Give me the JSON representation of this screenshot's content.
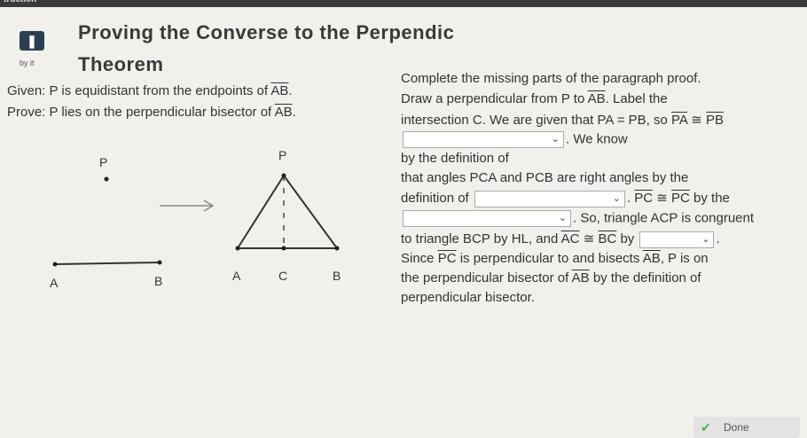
{
  "header": {
    "corner_text": "truction",
    "badge_sub": "by it",
    "title_line1": "Proving the Converse to the Perpendic",
    "title_line2": "Theorem"
  },
  "given": {
    "prefix": "Given: P is equidistant from the endpoints of",
    "segment": "AB",
    "suffix": "."
  },
  "prove": {
    "prefix": "Prove: P lies on the perpendicular bisector of",
    "segment": "AB",
    "suffix": "."
  },
  "paragraph": {
    "l1": "Complete the missing parts of the paragraph proof.",
    "l2_a": "Draw a perpendicular from P to",
    "l2_seg": "AB",
    "l2_b": ". Label the",
    "l3_a": "intersection C. We are given that PA = PB, so",
    "l3_seg1": "PA",
    "l3_cong": "≅",
    "l3_seg2": "PB",
    "l4_a": ". We know",
    "l5_a": "by the definition of",
    "l6_a": "that angles PCA and PCB are right angles by the",
    "l7_a": "definition of",
    "l7_b": ".",
    "l7_seg1": "PC",
    "l7_cong": "≅",
    "l7_seg2": "PC",
    "l7_c": "by the",
    "l8_b": ". So, triangle ACP is congruent",
    "l9_a": "to triangle BCP by HL, and",
    "l9_seg1": "AC",
    "l9_cong": "≅",
    "l9_seg2": "BC",
    "l9_b": "by",
    "l9_c": ".",
    "l10_a": "Since",
    "l10_seg": "PC",
    "l10_b": "is perpendicular to and bisects",
    "l10_seg2": "AB",
    "l10_c": ", P is on",
    "l11_a": "the perpendicular bisector of",
    "l11_seg": "AB",
    "l11_b": "by the definition of",
    "l12_a": "perpendicular bisector."
  },
  "figure1": {
    "p": "P",
    "a": "A",
    "b": "B"
  },
  "figure2": {
    "p": "P",
    "a": "A",
    "c": "C",
    "b": "B"
  },
  "dropdowns": {
    "chevron": "⌄"
  },
  "done": {
    "label": "Done",
    "icon": "check-icon"
  },
  "colors": {
    "accent": "#2c3e50",
    "done_check": "#4caf50"
  }
}
